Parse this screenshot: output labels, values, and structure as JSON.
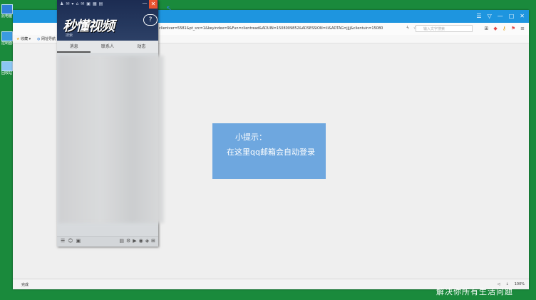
{
  "desktop": {
    "icons": [
      {
        "label": "此电脑",
        "icon": "computer-icon"
      },
      {
        "label": "控制面板",
        "icon": "control-panel-icon"
      },
      {
        "label": "回收站",
        "icon": "recycle-bin-icon"
      }
    ]
  },
  "browser": {
    "url": "clientver=5581&pt_src=1&keyindex=9&Fun=clientread&ADUIN=1508009852&ADSESSION=ili&ADTAG=jjjj&clientuin=15080",
    "search_placeholder": "输入文字搜索",
    "favorites": [
      {
        "label": "收藏"
      },
      {
        "label": "网址导航"
      }
    ],
    "status_text": "完成",
    "zoom": "100%",
    "accent_color": "#1e95df"
  },
  "tip": {
    "title": "小提示：",
    "message": "在这里qq邮箱会自动登录"
  },
  "qq": {
    "logo_text": "秒懂视频",
    "search_label": "搜索",
    "tabs": [
      {
        "label": "消息"
      },
      {
        "label": "联系人"
      },
      {
        "label": "动态"
      }
    ]
  },
  "caption": "解决你所有生活问题"
}
